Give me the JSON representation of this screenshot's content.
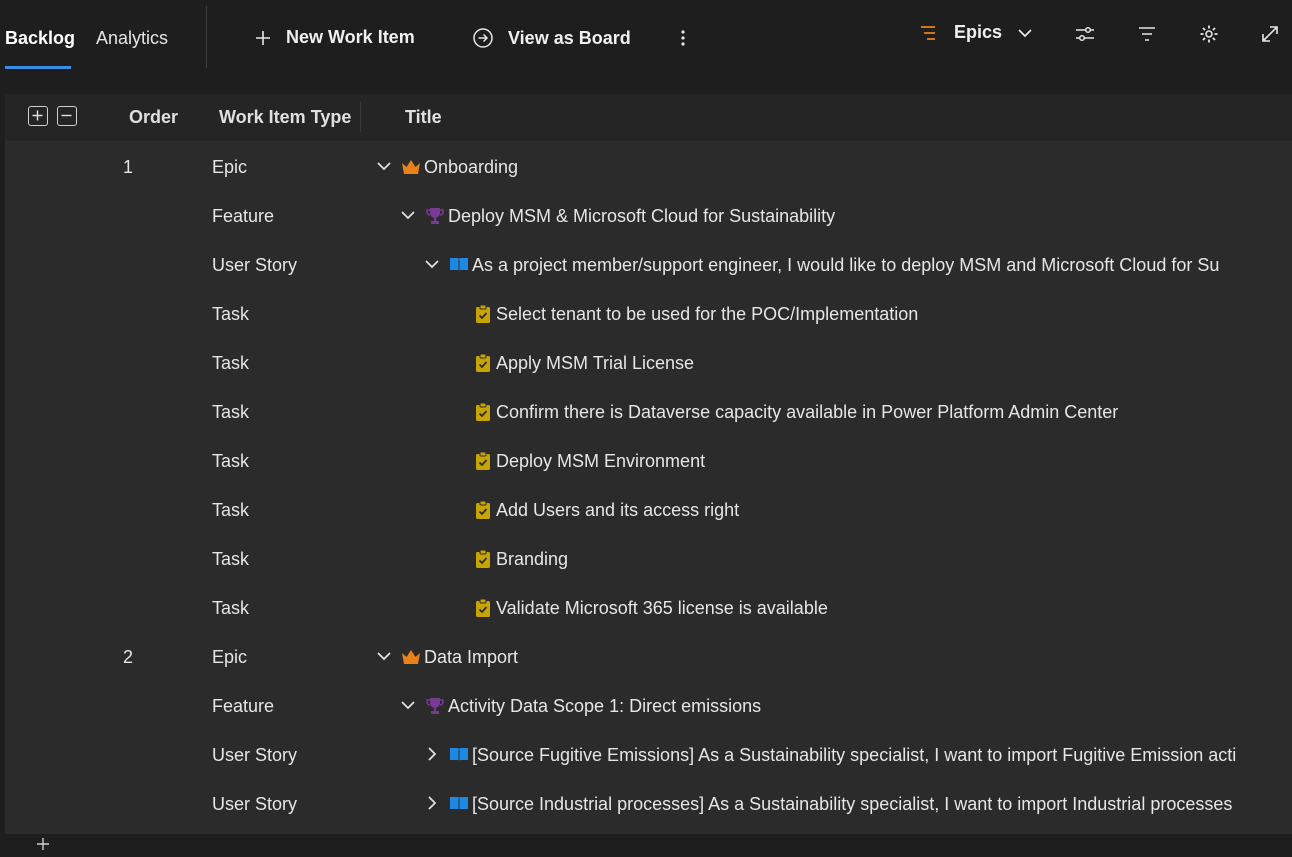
{
  "toolbar": {
    "tabs": [
      "Backlog",
      "Analytics"
    ],
    "new_work_item": "New Work Item",
    "view_as_board": "View as Board",
    "level_selector": "Epics"
  },
  "grid": {
    "headers": {
      "order": "Order",
      "type": "Work Item Type",
      "title": "Title"
    }
  },
  "rows": [
    {
      "order": "1",
      "type": "Epic",
      "title": "Onboarding",
      "icon": "crown-icon",
      "expanded": true
    },
    {
      "order": "",
      "type": "Feature",
      "title": "Deploy MSM & Microsoft Cloud for Sustainability",
      "icon": "trophy-icon",
      "expanded": true
    },
    {
      "order": "",
      "type": "User Story",
      "title": "As a project member/support engineer, I would like to deploy MSM and Microsoft Cloud for Su",
      "icon": "book-icon",
      "expanded": true
    },
    {
      "order": "",
      "type": "Task",
      "title": "Select tenant to be used for the POC/Implementation",
      "icon": "clipboard-check-icon"
    },
    {
      "order": "",
      "type": "Task",
      "title": "Apply MSM Trial License",
      "icon": "clipboard-check-icon"
    },
    {
      "order": "",
      "type": "Task",
      "title": "Confirm there is Dataverse capacity available in Power Platform Admin Center",
      "icon": "clipboard-check-icon"
    },
    {
      "order": "",
      "type": "Task",
      "title": "Deploy MSM Environment",
      "icon": "clipboard-check-icon"
    },
    {
      "order": "",
      "type": "Task",
      "title": "Add Users and its access right",
      "icon": "clipboard-check-icon"
    },
    {
      "order": "",
      "type": "Task",
      "title": "Branding",
      "icon": "clipboard-check-icon"
    },
    {
      "order": "",
      "type": "Task",
      "title": "Validate Microsoft 365 license is available",
      "icon": "clipboard-check-icon"
    },
    {
      "order": "2",
      "type": "Epic",
      "title": "Data Import",
      "icon": "crown-icon",
      "expanded": true
    },
    {
      "order": "",
      "type": "Feature",
      "title": "Activity Data Scope 1: Direct emissions",
      "icon": "trophy-icon",
      "expanded": true
    },
    {
      "order": "",
      "type": "User Story",
      "title": "[Source Fugitive Emissions] As a Sustainability specialist, I want to import Fugitive Emission acti",
      "icon": "book-icon",
      "expanded": false
    },
    {
      "order": "",
      "type": "User Story",
      "title": "[Source Industrial processes] As a Sustainability specialist, I want to import Industrial processes",
      "icon": "book-icon",
      "expanded": false
    }
  ],
  "colors": {
    "epic": "#e8811a",
    "feature": "#773b93",
    "user_story": "#1e88e5",
    "task": "#c8a400",
    "accent": "#3a8ee6"
  }
}
